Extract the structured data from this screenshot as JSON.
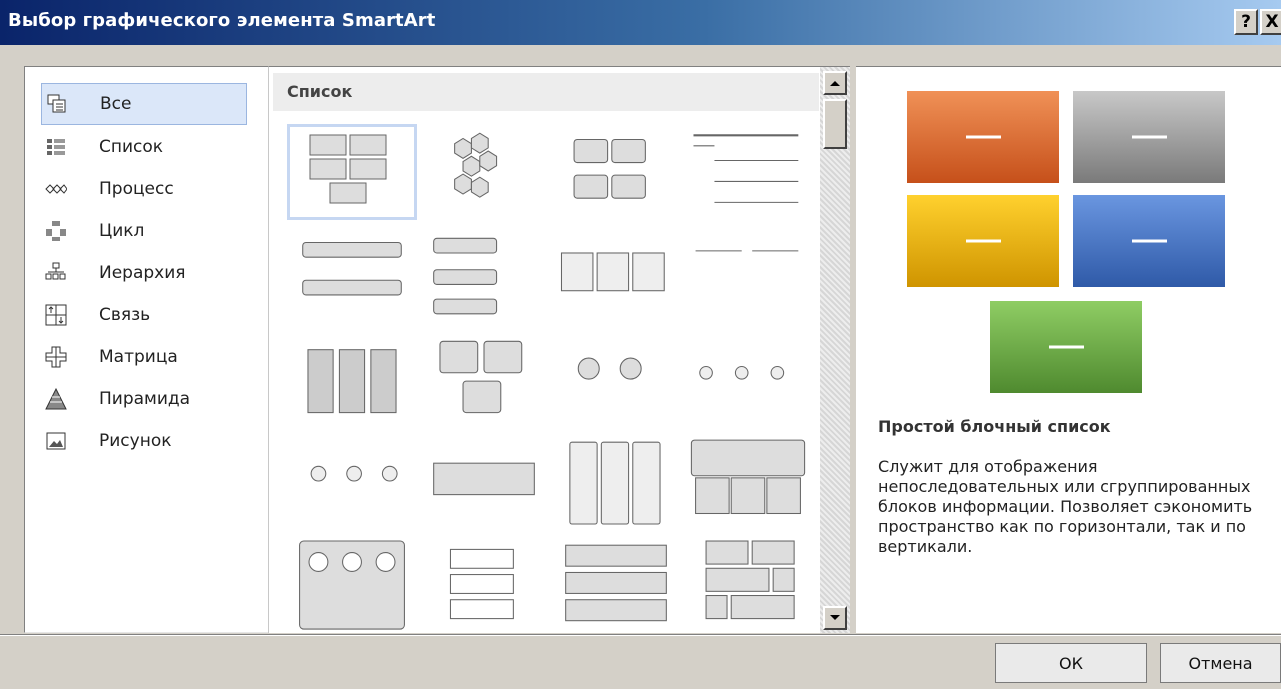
{
  "dialog": {
    "title": "Выбор графического элемента SmartArt",
    "help_label": "?",
    "close_label": "X"
  },
  "categories": [
    {
      "label": "Все",
      "icon": "all-icon",
      "selected": true
    },
    {
      "label": "Список",
      "icon": "list-icon"
    },
    {
      "label": "Процесс",
      "icon": "process-icon"
    },
    {
      "label": "Цикл",
      "icon": "cycle-icon"
    },
    {
      "label": "Иерархия",
      "icon": "hierarchy-icon"
    },
    {
      "label": "Связь",
      "icon": "relationship-icon"
    },
    {
      "label": "Матрица",
      "icon": "matrix-icon"
    },
    {
      "label": "Пирамида",
      "icon": "pyramid-icon"
    },
    {
      "label": "Рисунок",
      "icon": "picture-icon"
    }
  ],
  "gallery": {
    "section_label": "Список"
  },
  "preview": {
    "colors": [
      "#d4622a",
      "#8c8c8c",
      "#e0ac14",
      "#4472c4",
      "#70ad47"
    ],
    "title": "Простой блочный список",
    "description": "Служит для отображения непоследовательных или сгруппированных блоков информации. Позволяет сэкономить пространство как по горизонтали, так и по вертикали."
  },
  "buttons": {
    "ok": "ОК",
    "cancel": "Отмена"
  }
}
